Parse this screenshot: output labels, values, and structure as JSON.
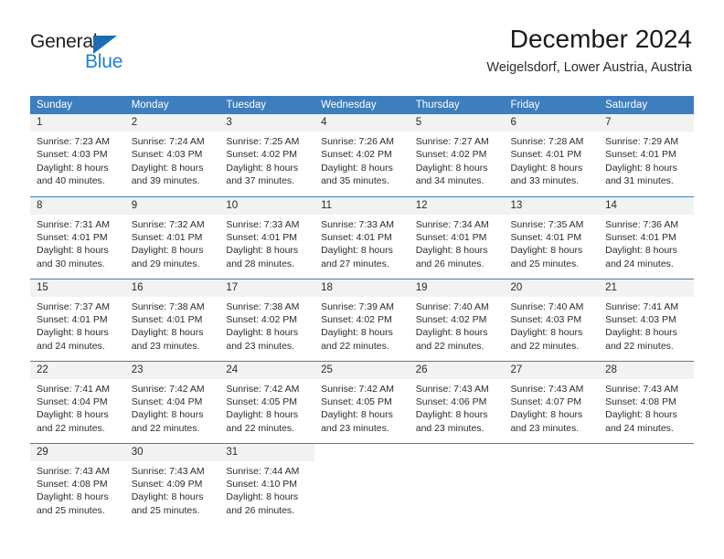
{
  "brand": {
    "name_part1": "General",
    "name_part2": "Blue",
    "triangle_color": "#1b6cb5",
    "blue_color": "#1d82d4"
  },
  "header": {
    "title": "December 2024",
    "subtitle": "Weigelsdorf, Lower Austria, Austria"
  },
  "theme": {
    "header_bg": "#3d7ebf",
    "daynum_bg": "#f2f2f2",
    "row_rule": "#3d7ebf"
  },
  "weekday_headers": [
    "Sunday",
    "Monday",
    "Tuesday",
    "Wednesday",
    "Thursday",
    "Friday",
    "Saturday"
  ],
  "weeks": [
    [
      {
        "day": "1",
        "sunrise": "Sunrise: 7:23 AM",
        "sunset": "Sunset: 4:03 PM",
        "daylight1": "Daylight: 8 hours",
        "daylight2": "and 40 minutes."
      },
      {
        "day": "2",
        "sunrise": "Sunrise: 7:24 AM",
        "sunset": "Sunset: 4:03 PM",
        "daylight1": "Daylight: 8 hours",
        "daylight2": "and 39 minutes."
      },
      {
        "day": "3",
        "sunrise": "Sunrise: 7:25 AM",
        "sunset": "Sunset: 4:02 PM",
        "daylight1": "Daylight: 8 hours",
        "daylight2": "and 37 minutes."
      },
      {
        "day": "4",
        "sunrise": "Sunrise: 7:26 AM",
        "sunset": "Sunset: 4:02 PM",
        "daylight1": "Daylight: 8 hours",
        "daylight2": "and 35 minutes."
      },
      {
        "day": "5",
        "sunrise": "Sunrise: 7:27 AM",
        "sunset": "Sunset: 4:02 PM",
        "daylight1": "Daylight: 8 hours",
        "daylight2": "and 34 minutes."
      },
      {
        "day": "6",
        "sunrise": "Sunrise: 7:28 AM",
        "sunset": "Sunset: 4:01 PM",
        "daylight1": "Daylight: 8 hours",
        "daylight2": "and 33 minutes."
      },
      {
        "day": "7",
        "sunrise": "Sunrise: 7:29 AM",
        "sunset": "Sunset: 4:01 PM",
        "daylight1": "Daylight: 8 hours",
        "daylight2": "and 31 minutes."
      }
    ],
    [
      {
        "day": "8",
        "sunrise": "Sunrise: 7:31 AM",
        "sunset": "Sunset: 4:01 PM",
        "daylight1": "Daylight: 8 hours",
        "daylight2": "and 30 minutes."
      },
      {
        "day": "9",
        "sunrise": "Sunrise: 7:32 AM",
        "sunset": "Sunset: 4:01 PM",
        "daylight1": "Daylight: 8 hours",
        "daylight2": "and 29 minutes."
      },
      {
        "day": "10",
        "sunrise": "Sunrise: 7:33 AM",
        "sunset": "Sunset: 4:01 PM",
        "daylight1": "Daylight: 8 hours",
        "daylight2": "and 28 minutes."
      },
      {
        "day": "11",
        "sunrise": "Sunrise: 7:33 AM",
        "sunset": "Sunset: 4:01 PM",
        "daylight1": "Daylight: 8 hours",
        "daylight2": "and 27 minutes."
      },
      {
        "day": "12",
        "sunrise": "Sunrise: 7:34 AM",
        "sunset": "Sunset: 4:01 PM",
        "daylight1": "Daylight: 8 hours",
        "daylight2": "and 26 minutes."
      },
      {
        "day": "13",
        "sunrise": "Sunrise: 7:35 AM",
        "sunset": "Sunset: 4:01 PM",
        "daylight1": "Daylight: 8 hours",
        "daylight2": "and 25 minutes."
      },
      {
        "day": "14",
        "sunrise": "Sunrise: 7:36 AM",
        "sunset": "Sunset: 4:01 PM",
        "daylight1": "Daylight: 8 hours",
        "daylight2": "and 24 minutes."
      }
    ],
    [
      {
        "day": "15",
        "sunrise": "Sunrise: 7:37 AM",
        "sunset": "Sunset: 4:01 PM",
        "daylight1": "Daylight: 8 hours",
        "daylight2": "and 24 minutes."
      },
      {
        "day": "16",
        "sunrise": "Sunrise: 7:38 AM",
        "sunset": "Sunset: 4:01 PM",
        "daylight1": "Daylight: 8 hours",
        "daylight2": "and 23 minutes."
      },
      {
        "day": "17",
        "sunrise": "Sunrise: 7:38 AM",
        "sunset": "Sunset: 4:02 PM",
        "daylight1": "Daylight: 8 hours",
        "daylight2": "and 23 minutes."
      },
      {
        "day": "18",
        "sunrise": "Sunrise: 7:39 AM",
        "sunset": "Sunset: 4:02 PM",
        "daylight1": "Daylight: 8 hours",
        "daylight2": "and 22 minutes."
      },
      {
        "day": "19",
        "sunrise": "Sunrise: 7:40 AM",
        "sunset": "Sunset: 4:02 PM",
        "daylight1": "Daylight: 8 hours",
        "daylight2": "and 22 minutes."
      },
      {
        "day": "20",
        "sunrise": "Sunrise: 7:40 AM",
        "sunset": "Sunset: 4:03 PM",
        "daylight1": "Daylight: 8 hours",
        "daylight2": "and 22 minutes."
      },
      {
        "day": "21",
        "sunrise": "Sunrise: 7:41 AM",
        "sunset": "Sunset: 4:03 PM",
        "daylight1": "Daylight: 8 hours",
        "daylight2": "and 22 minutes."
      }
    ],
    [
      {
        "day": "22",
        "sunrise": "Sunrise: 7:41 AM",
        "sunset": "Sunset: 4:04 PM",
        "daylight1": "Daylight: 8 hours",
        "daylight2": "and 22 minutes."
      },
      {
        "day": "23",
        "sunrise": "Sunrise: 7:42 AM",
        "sunset": "Sunset: 4:04 PM",
        "daylight1": "Daylight: 8 hours",
        "daylight2": "and 22 minutes."
      },
      {
        "day": "24",
        "sunrise": "Sunrise: 7:42 AM",
        "sunset": "Sunset: 4:05 PM",
        "daylight1": "Daylight: 8 hours",
        "daylight2": "and 22 minutes."
      },
      {
        "day": "25",
        "sunrise": "Sunrise: 7:42 AM",
        "sunset": "Sunset: 4:05 PM",
        "daylight1": "Daylight: 8 hours",
        "daylight2": "and 23 minutes."
      },
      {
        "day": "26",
        "sunrise": "Sunrise: 7:43 AM",
        "sunset": "Sunset: 4:06 PM",
        "daylight1": "Daylight: 8 hours",
        "daylight2": "and 23 minutes."
      },
      {
        "day": "27",
        "sunrise": "Sunrise: 7:43 AM",
        "sunset": "Sunset: 4:07 PM",
        "daylight1": "Daylight: 8 hours",
        "daylight2": "and 23 minutes."
      },
      {
        "day": "28",
        "sunrise": "Sunrise: 7:43 AM",
        "sunset": "Sunset: 4:08 PM",
        "daylight1": "Daylight: 8 hours",
        "daylight2": "and 24 minutes."
      }
    ],
    [
      {
        "day": "29",
        "sunrise": "Sunrise: 7:43 AM",
        "sunset": "Sunset: 4:08 PM",
        "daylight1": "Daylight: 8 hours",
        "daylight2": "and 25 minutes."
      },
      {
        "day": "30",
        "sunrise": "Sunrise: 7:43 AM",
        "sunset": "Sunset: 4:09 PM",
        "daylight1": "Daylight: 8 hours",
        "daylight2": "and 25 minutes."
      },
      {
        "day": "31",
        "sunrise": "Sunrise: 7:44 AM",
        "sunset": "Sunset: 4:10 PM",
        "daylight1": "Daylight: 8 hours",
        "daylight2": "and 26 minutes."
      },
      {
        "day": "",
        "sunrise": "",
        "sunset": "",
        "daylight1": "",
        "daylight2": ""
      },
      {
        "day": "",
        "sunrise": "",
        "sunset": "",
        "daylight1": "",
        "daylight2": ""
      },
      {
        "day": "",
        "sunrise": "",
        "sunset": "",
        "daylight1": "",
        "daylight2": ""
      },
      {
        "day": "",
        "sunrise": "",
        "sunset": "",
        "daylight1": "",
        "daylight2": ""
      }
    ]
  ]
}
